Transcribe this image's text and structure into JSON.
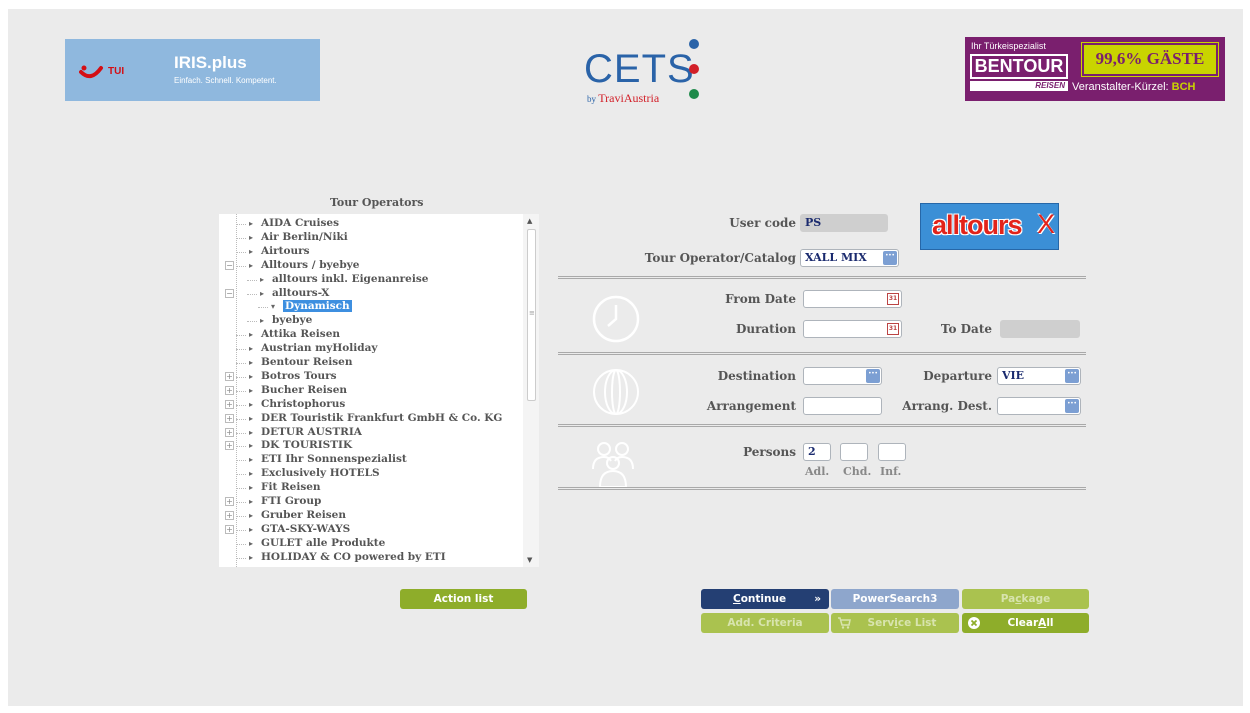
{
  "banners": {
    "tui": {
      "brand": "TUI",
      "product": "IRIS.plus",
      "slogan": "Einfach. Schnell. Kompetent."
    },
    "cets": {
      "name": "CETS",
      "by": "by",
      "by_brand": "TraviAustria"
    },
    "bentour": {
      "tagline": "Ihr Türkeispezialist",
      "name": "BENTOUR",
      "reisen": "REISEN",
      "badge": "99,6% GÄSTE",
      "kuerzel_label": "Veranstalter-Kürzel:",
      "kuerzel_value": "BCH"
    }
  },
  "tour_operators": {
    "title": "Tour Operators",
    "items": [
      {
        "label": "AIDA Cruises",
        "level": 0,
        "arrow": "▸",
        "expander": ""
      },
      {
        "label": "Air Berlin/Niki",
        "level": 0,
        "arrow": "▸",
        "expander": ""
      },
      {
        "label": "Airtours",
        "level": 0,
        "arrow": "▸",
        "expander": ""
      },
      {
        "label": "Alltours / byebye",
        "level": 0,
        "arrow": "▸",
        "expander": "−"
      },
      {
        "label": "alltours inkl. Eigenanreise",
        "level": 1,
        "arrow": "▸",
        "expander": ""
      },
      {
        "label": "alltours-X",
        "level": 1,
        "arrow": "▸",
        "expander": "−"
      },
      {
        "label": "Dynamisch",
        "level": 2,
        "arrow": "▾",
        "expander": "",
        "selected": true
      },
      {
        "label": "byebye",
        "level": 1,
        "arrow": "▸",
        "expander": ""
      },
      {
        "label": "Attika Reisen",
        "level": 0,
        "arrow": "▸",
        "expander": ""
      },
      {
        "label": "Austrian myHoliday",
        "level": 0,
        "arrow": "▸",
        "expander": ""
      },
      {
        "label": "Bentour Reisen",
        "level": 0,
        "arrow": "▸",
        "expander": ""
      },
      {
        "label": "Botros Tours",
        "level": 0,
        "arrow": "▸",
        "expander": "+"
      },
      {
        "label": "Bucher Reisen",
        "level": 0,
        "arrow": "▸",
        "expander": "+"
      },
      {
        "label": "Christophorus",
        "level": 0,
        "arrow": "▸",
        "expander": "+"
      },
      {
        "label": "DER Touristik Frankfurt GmbH & Co. KG",
        "level": 0,
        "arrow": "▸",
        "expander": "+"
      },
      {
        "label": "DETUR AUSTRIA",
        "level": 0,
        "arrow": "▸",
        "expander": "+"
      },
      {
        "label": "DK TOURISTIK",
        "level": 0,
        "arrow": "▸",
        "expander": "+"
      },
      {
        "label": "ETI Ihr Sonnenspezialist",
        "level": 0,
        "arrow": "▸",
        "expander": ""
      },
      {
        "label": "Exclusively HOTELS",
        "level": 0,
        "arrow": "▸",
        "expander": ""
      },
      {
        "label": "Fit Reisen",
        "level": 0,
        "arrow": "▸",
        "expander": ""
      },
      {
        "label": "FTI Group",
        "level": 0,
        "arrow": "▸",
        "expander": "+"
      },
      {
        "label": "Gruber Reisen",
        "level": 0,
        "arrow": "▸",
        "expander": "+"
      },
      {
        "label": "GTA-SKY-WAYS",
        "level": 0,
        "arrow": "▸",
        "expander": "+"
      },
      {
        "label": "GULET alle Produkte",
        "level": 0,
        "arrow": "▸",
        "expander": ""
      },
      {
        "label": "HOLIDAY & CO powered by ETI",
        "level": 0,
        "arrow": "▸",
        "expander": ""
      }
    ]
  },
  "form": {
    "user_code": {
      "label": "User code",
      "value": "PS"
    },
    "tour_operator_catalog": {
      "label": "Tour Operator/Catalog",
      "value": "XALL MIX"
    },
    "alltours_logo": {
      "main": "alltours",
      "x": "X"
    },
    "from_date": {
      "label": "From Date",
      "value": ""
    },
    "duration": {
      "label": "Duration",
      "value": ""
    },
    "to_date": {
      "label": "To Date",
      "value": ""
    },
    "destination": {
      "label": "Destination",
      "value": ""
    },
    "departure": {
      "label": "Departure",
      "value": "VIE"
    },
    "arrangement": {
      "label": "Arrangement",
      "value": ""
    },
    "arrang_dest": {
      "label": "Arrang. Dest.",
      "value": ""
    },
    "persons": {
      "label": "Persons",
      "adl": "2",
      "chd": "",
      "inf": "",
      "adl_label": "Adl.",
      "chd_label": "Chd.",
      "inf_label": "Inf."
    },
    "calendar_glyph": "31",
    "dots_glyph": "···"
  },
  "buttons": {
    "action_list": "Action list",
    "continue_pre": "",
    "continue_ul": "C",
    "continue_post": "ontinue",
    "continue_arrow": "»",
    "powersearch": "PowerSearch3",
    "package_pre": "Pa",
    "package_ul": "c",
    "package_post": "kage",
    "add_criteria": "Add. Criteria",
    "service_pre": "Serv",
    "service_ul": "i",
    "service_post": "ce List",
    "clear_pre": "Clear",
    "clear_ul": "A",
    "clear_post": "ll"
  },
  "colors": {
    "background": "#ebebeb",
    "accent_green": "#8ead2a",
    "navy": "#243f73",
    "selection": "#3d8fe0"
  }
}
